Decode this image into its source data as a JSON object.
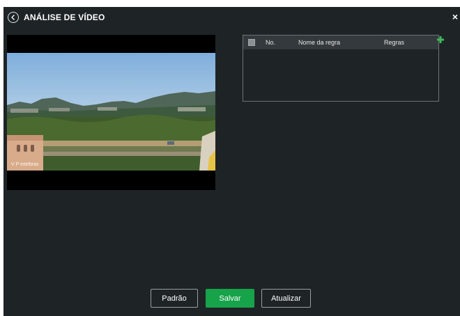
{
  "dialog": {
    "title": "ANÁLISE DE VÍDEO",
    "close_symbol": "×",
    "back_icon": "chevron-left-circle-icon"
  },
  "video": {
    "watermark": "V P intelbras"
  },
  "rules_table": {
    "columns": {
      "no": "No.",
      "name": "Nome da regra",
      "rules": "Regras"
    },
    "add_icon": "plus-icon",
    "rows": []
  },
  "footer": {
    "default_label": "Padrão",
    "save_label": "Salvar",
    "refresh_label": "Atualizar"
  },
  "colors": {
    "background": "#1e2426",
    "accent": "#16a34a",
    "add_icon": "#3fb85a"
  }
}
